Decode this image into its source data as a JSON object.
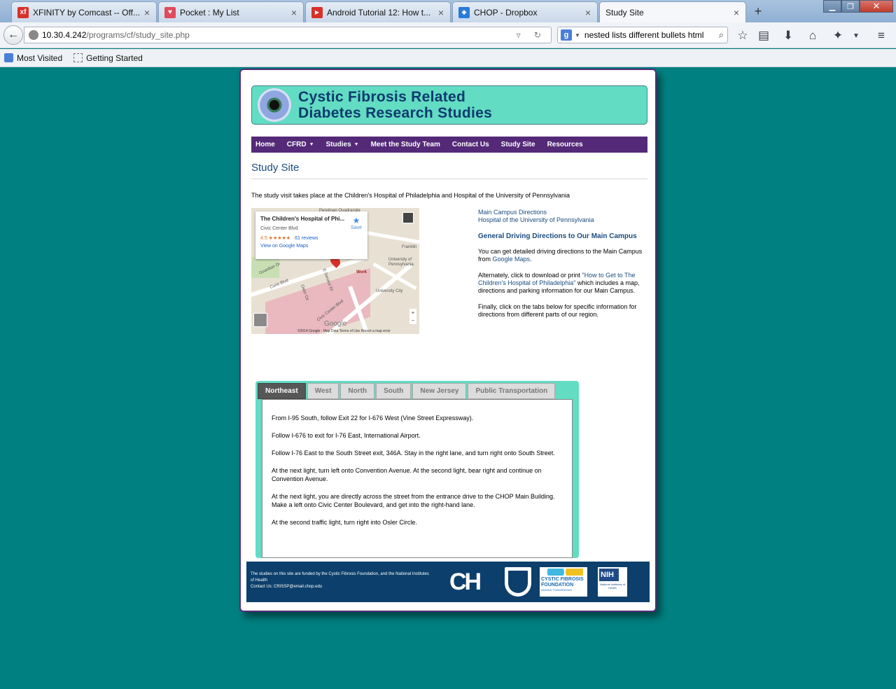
{
  "browser": {
    "tabs": [
      {
        "title": "XFINITY by Comcast -- Off...",
        "icon": "xfinity-icon",
        "color": "#d9302a",
        "glyph": "xf"
      },
      {
        "title": "Pocket : My List",
        "icon": "pocket-icon",
        "color": "#e04a5a",
        "glyph": "♥"
      },
      {
        "title": "Android Tutorial 12: How t...",
        "icon": "youtube-icon",
        "color": "#d9302a",
        "glyph": "▶"
      },
      {
        "title": "CHOP - Dropbox",
        "icon": "dropbox-icon",
        "color": "#2a7ad9",
        "glyph": "◆"
      },
      {
        "title": "Study Site",
        "icon": "blank-icon",
        "color": "#ffffff",
        "glyph": ""
      }
    ],
    "url": {
      "host": "10.30.4.242",
      "path": "/programs/cf/study_site.php"
    },
    "search": {
      "value": "nested lists different bullets html"
    },
    "bookmarks": [
      "Most Visited",
      "Getting Started"
    ]
  },
  "site": {
    "logo_line1": "Cystic Fibrosis Related",
    "logo_line2": "Diabetes Research Studies",
    "nav": [
      {
        "label": "Home",
        "dropdown": false
      },
      {
        "label": "CFRD",
        "dropdown": true
      },
      {
        "label": "Studies",
        "dropdown": true
      },
      {
        "label": "Meet the Study Team",
        "dropdown": false
      },
      {
        "label": "Contact Us",
        "dropdown": false
      },
      {
        "label": "Study Site",
        "dropdown": false
      },
      {
        "label": "Resources",
        "dropdown": false
      }
    ],
    "page_title": "Study Site",
    "intro": "The study visit takes place at the Children's Hospital of Philadelphia and Hospital of the University of Pennsylvania"
  },
  "map": {
    "place_name": "The Children's Hospital of Phi...",
    "place_street": "Civic Center Blvd",
    "rating": "4.5 ★★★★★",
    "reviews": "61 reviews",
    "view_link": "View on Google Maps",
    "save": "Save",
    "labels": [
      "Perelman Quadrangle",
      "Franklin",
      "University of Pennsylvania",
      "University City",
      "Work",
      "Guardian Dr",
      "Curie Blvd",
      "Osler Cir",
      "E Service Dr",
      "Civic Center Blvd"
    ],
    "brand": "Google",
    "footer": "©2014 Google · Map Data    Terms of Use    Report a map error"
  },
  "directions": {
    "link1": "Main Campus Directions",
    "link2": "Hospital of the University of Pennsylvania",
    "heading": "General Driving Directions to Our Main Campus",
    "p1_pre": "You can get detailed driving directions to the Main Campus from ",
    "p1_link": "Google Maps",
    "p1_post": ".",
    "p2_pre": "Alternately, click to download or print ",
    "p2_link": "\"How to Get to The Children's Hospital of Philadelphia\"",
    "p2_post": " which includes a map, directions and parking information for our Main Campus.",
    "p3": "Finally, click on the tabs below for specific information for directions from different parts of our region."
  },
  "direction_tabs": {
    "tabs": [
      "Northeast",
      "West",
      "North",
      "South",
      "New Jersey",
      "Public Transportation"
    ],
    "active": "Northeast",
    "content": [
      "From I-95 South, follow Exit 22 for I-676 West (Vine Street Expressway).",
      "Follow I-676 to exit for I-76 East, International Airport.",
      "Follow I-76 East to the South Street exit, 346A. Stay in the right lane, and turn right onto South Street.",
      "At the next light, turn left onto Convention Avenue. At the second light, bear right and continue on Convention Avenue.",
      "At the next light, you are directly across the street from the entrance drive to the CHOP Main Building. Make a left onto Civic Center Boulevard, and get into the right-hand lane.",
      "At the second traffic light, turn right into Osler Circle."
    ]
  },
  "footer": {
    "funding": "The studies on this site are funded by the Cystic Fibrosis Foundation, and the National Institutes of Health",
    "contact": "Contact Us: CRISSP@email.chop.edu",
    "chop_logo": "CH",
    "cff_line1": "CYSTIC FIBROSIS",
    "cff_line2": "FOUNDATION",
    "cff_tag": "ADDING TOMORROWS",
    "nih": "NIH",
    "nih_sub": "National Institutes of Health"
  },
  "colors": {
    "background": "#008080",
    "banner": "#62dcc3",
    "nav": "#542a78",
    "footer": "#0c3f6b"
  }
}
